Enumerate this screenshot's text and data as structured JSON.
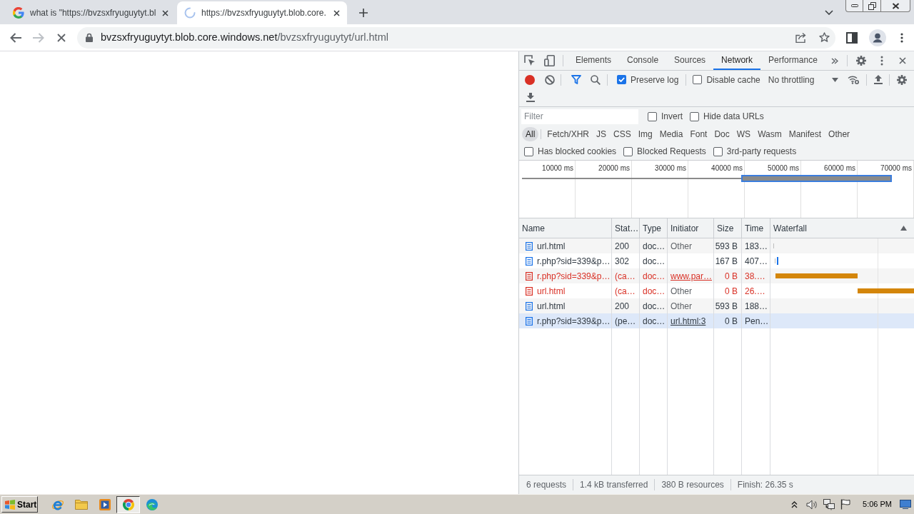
{
  "browser": {
    "tabs": [
      {
        "title": "what is \"https://bvzsxfryuguytyt.bl",
        "selected": false,
        "loading": false
      },
      {
        "title": "https://bvzsxfryuguytyt.blob.core.",
        "selected": true,
        "loading": true
      }
    ],
    "back_disabled": false,
    "forward_disabled": true,
    "loading": true,
    "address": {
      "host": "bvzsxfryuguytyt.blob.core.windows.net",
      "path": "/bvzsxfryuguytyt/url.html"
    }
  },
  "devtools": {
    "tabs": [
      {
        "label": "Elements",
        "selected": false
      },
      {
        "label": "Console",
        "selected": false
      },
      {
        "label": "Sources",
        "selected": false
      },
      {
        "label": "Network",
        "selected": true
      },
      {
        "label": "Performance",
        "selected": false
      }
    ],
    "recording": true,
    "options": [
      {
        "label": "Preserve log",
        "checked": true
      },
      {
        "label": "Disable cache",
        "checked": false
      }
    ],
    "throttling": "No throttling",
    "filter": {
      "placeholder": "Filter"
    },
    "filter_options": [
      {
        "label": "Invert",
        "checked": false
      },
      {
        "label": "Hide data URLs",
        "checked": false
      }
    ],
    "resource_types": [
      {
        "label": "All",
        "selected": true
      },
      {
        "label": "Fetch/XHR",
        "selected": false
      },
      {
        "label": "JS",
        "selected": false
      },
      {
        "label": "CSS",
        "selected": false
      },
      {
        "label": "Img",
        "selected": false
      },
      {
        "label": "Media",
        "selected": false
      },
      {
        "label": "Font",
        "selected": false
      },
      {
        "label": "Doc",
        "selected": false
      },
      {
        "label": "WS",
        "selected": false
      },
      {
        "label": "Wasm",
        "selected": false
      },
      {
        "label": "Manifest",
        "selected": false
      },
      {
        "label": "Other",
        "selected": false
      }
    ],
    "request_filters": [
      {
        "label": "Has blocked cookies",
        "checked": false
      },
      {
        "label": "Blocked Requests",
        "checked": false
      },
      {
        "label": "3rd-party requests",
        "checked": false
      }
    ],
    "overview": {
      "ticks": [
        "10000 ms",
        "20000 ms",
        "30000 ms",
        "40000 ms",
        "50000 ms",
        "60000 ms",
        "70000 ms"
      ]
    },
    "table": {
      "columns": [
        "Name",
        "Stat…",
        "Type",
        "Initiator",
        "Size",
        "Time",
        "Waterfall"
      ],
      "rows": [
        {
          "name": "url.html",
          "status": "200",
          "type": "doc…",
          "initiator": "Other",
          "initiator_link": false,
          "size": "593 B",
          "time": "183…",
          "failed": false,
          "selected": false
        },
        {
          "name": "r.php?sid=339&p…",
          "status": "302",
          "type": "doc…",
          "size": "167 B",
          "time": "407…",
          "failed": false,
          "selected": false
        },
        {
          "name": "r.php?sid=339&p…",
          "status": "(ca…",
          "type": "doc…",
          "initiator": "www.par…",
          "initiator_link": true,
          "size": "0 B",
          "time": "38.…",
          "failed": true,
          "selected": false
        },
        {
          "name": "url.html",
          "status": "(ca…",
          "type": "doc…",
          "initiator": "Other",
          "initiator_link": false,
          "size": "0 B",
          "time": "26.…",
          "failed": true,
          "selected": false
        },
        {
          "name": "url.html",
          "status": "200",
          "type": "doc…",
          "initiator": "Other",
          "initiator_link": false,
          "size": "593 B",
          "time": "188…",
          "failed": false,
          "selected": false
        },
        {
          "name": "r.php?sid=339&p…",
          "status": "(pe…",
          "type": "doc…",
          "initiator": "url.html:3",
          "initiator_link": true,
          "size": "0 B",
          "time": "Pen…",
          "failed": false,
          "selected": true
        }
      ]
    },
    "status_bar": [
      "6 requests",
      "1.4 kB transferred",
      "380 B resources",
      "Finish: 26.35 s"
    ]
  },
  "taskbar": {
    "start": "Start",
    "apps": [
      {
        "kind": "e-logo",
        "selected": false
      },
      {
        "kind": "folder",
        "selected": false
      },
      {
        "kind": "player",
        "selected": false
      },
      {
        "kind": "ring-logo",
        "selected": true
      },
      {
        "kind": "wave-logo",
        "selected": false
      }
    ],
    "clock": "5:06 PM"
  }
}
